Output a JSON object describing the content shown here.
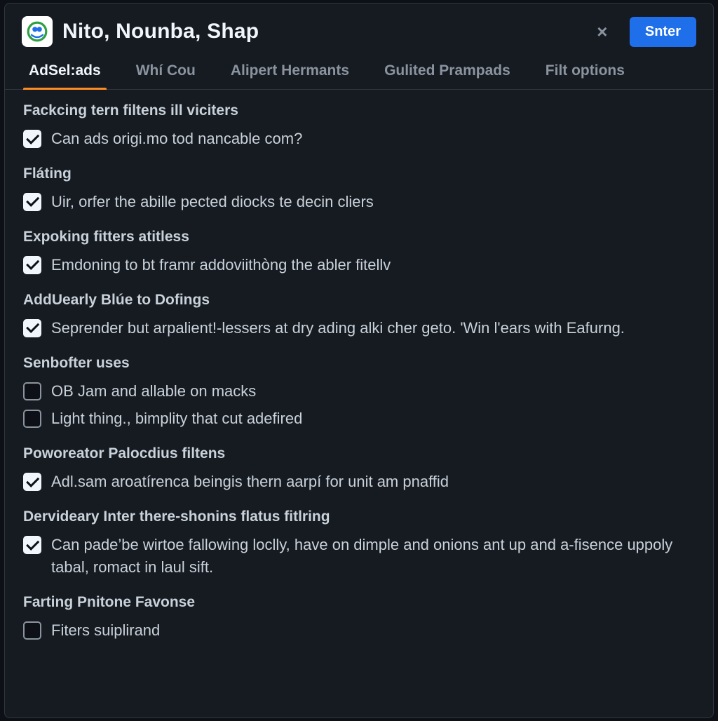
{
  "header": {
    "title": "Nito, Nounba, Shap",
    "close_label": "×",
    "primary_button": "Snter"
  },
  "tabs": [
    {
      "label": "AdSel:ads",
      "active": true
    },
    {
      "label": "Whí Cou",
      "active": false
    },
    {
      "label": "Alipert Hermants",
      "active": false
    },
    {
      "label": "Gulited Prampads",
      "active": false
    },
    {
      "label": "Filt options",
      "active": false
    }
  ],
  "sections": [
    {
      "title": "Fackcing tern filtens ill viciters",
      "items": [
        {
          "checked": true,
          "label": "Can ads origi.mo tod nancable com?"
        }
      ]
    },
    {
      "title": "Fláting",
      "items": [
        {
          "checked": true,
          "label": "Uir, orfer the abille pected diocks te decin cliers"
        }
      ]
    },
    {
      "title": "Expoking fitters atitless",
      "items": [
        {
          "checked": true,
          "label": "Emdoning to bt framr addoviithòng the abler fitellv"
        }
      ]
    },
    {
      "title": "AddUearly Blúe to Dofings",
      "items": [
        {
          "checked": true,
          "label": "Seprender but arpalient!-lessers at dry ading  alki cher geto. 'Win l'ears with Eafurng."
        }
      ]
    },
    {
      "title": "Senbofter uses",
      "items": [
        {
          "checked": false,
          "label": "OB Jam and allable on macks"
        },
        {
          "checked": false,
          "label": "Light thing., bimplity that cut adefired"
        }
      ]
    },
    {
      "title": "Poworeator Palocdius filtens",
      "items": [
        {
          "checked": true,
          "label": "Adl.sam aroatírenca beingis thern aarpí for unit am pnaffid"
        }
      ]
    },
    {
      "title": "Dervideary Inter there-shonins flatus fitlring",
      "items": [
        {
          "checked": true,
          "label": "Can pade’be wirtoe fallowing loclly, have on dimple and onions ant up and a-fisence uppoly tabal, romact in laul sift."
        }
      ]
    },
    {
      "title": "Farting Pnitone Favonse",
      "items": [
        {
          "checked": false,
          "label": "Fiters suiplirand"
        }
      ]
    }
  ]
}
